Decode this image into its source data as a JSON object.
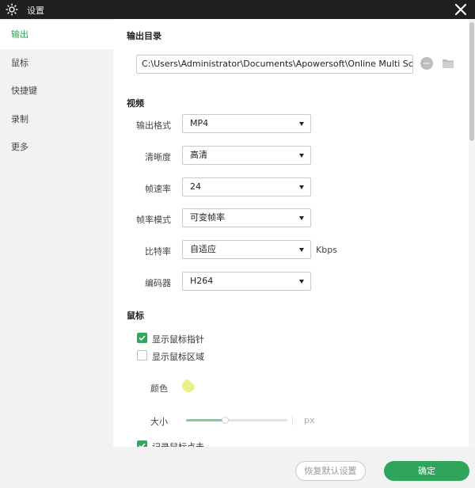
{
  "window": {
    "title": "设置",
    "app_icon": "gear-icon",
    "close_icon": "close-icon"
  },
  "sidebar": {
    "items": [
      {
        "label": "输出",
        "active": true
      },
      {
        "label": "鼠标",
        "active": false
      },
      {
        "label": "快捷键",
        "active": false
      },
      {
        "label": "录制",
        "active": false
      },
      {
        "label": "更多",
        "active": false
      }
    ]
  },
  "output": {
    "section_title": "输出目录",
    "path": "C:\\Users\\Administrator\\Documents\\Apowersoft\\Online Multi Scr",
    "more_icon": "more-options-icon",
    "folder_icon": "folder-icon"
  },
  "video": {
    "section_title": "视频",
    "fields": [
      {
        "label": "输出格式",
        "value": "MP4"
      },
      {
        "label": "清晰度",
        "value": "高清"
      },
      {
        "label": "帧速率",
        "value": "24"
      },
      {
        "label": "帧率模式",
        "value": "可变帧率"
      },
      {
        "label": "比特率",
        "value": "自适应",
        "unit": "Kbps"
      },
      {
        "label": "编码器",
        "value": "H264"
      }
    ]
  },
  "mouse": {
    "section_title": "鼠标",
    "show_pointer": {
      "label": "显示鼠标指针",
      "checked": true
    },
    "show_area": {
      "label": "显示鼠标区域",
      "checked": false
    },
    "color": {
      "label": "颜色",
      "value": "#e8f08a"
    },
    "size": {
      "label": "大小",
      "value_fraction": 0.38,
      "unit": "px"
    },
    "record_clicks": {
      "label": "记录鼠标点击",
      "checked": true
    }
  },
  "footer": {
    "reset_label": "恢复默认设置",
    "ok_label": "确定"
  },
  "colors": {
    "accent": "#2ea55a",
    "titlebar": "#1f1f1f",
    "sidebar_bg": "#f2f2f2"
  }
}
